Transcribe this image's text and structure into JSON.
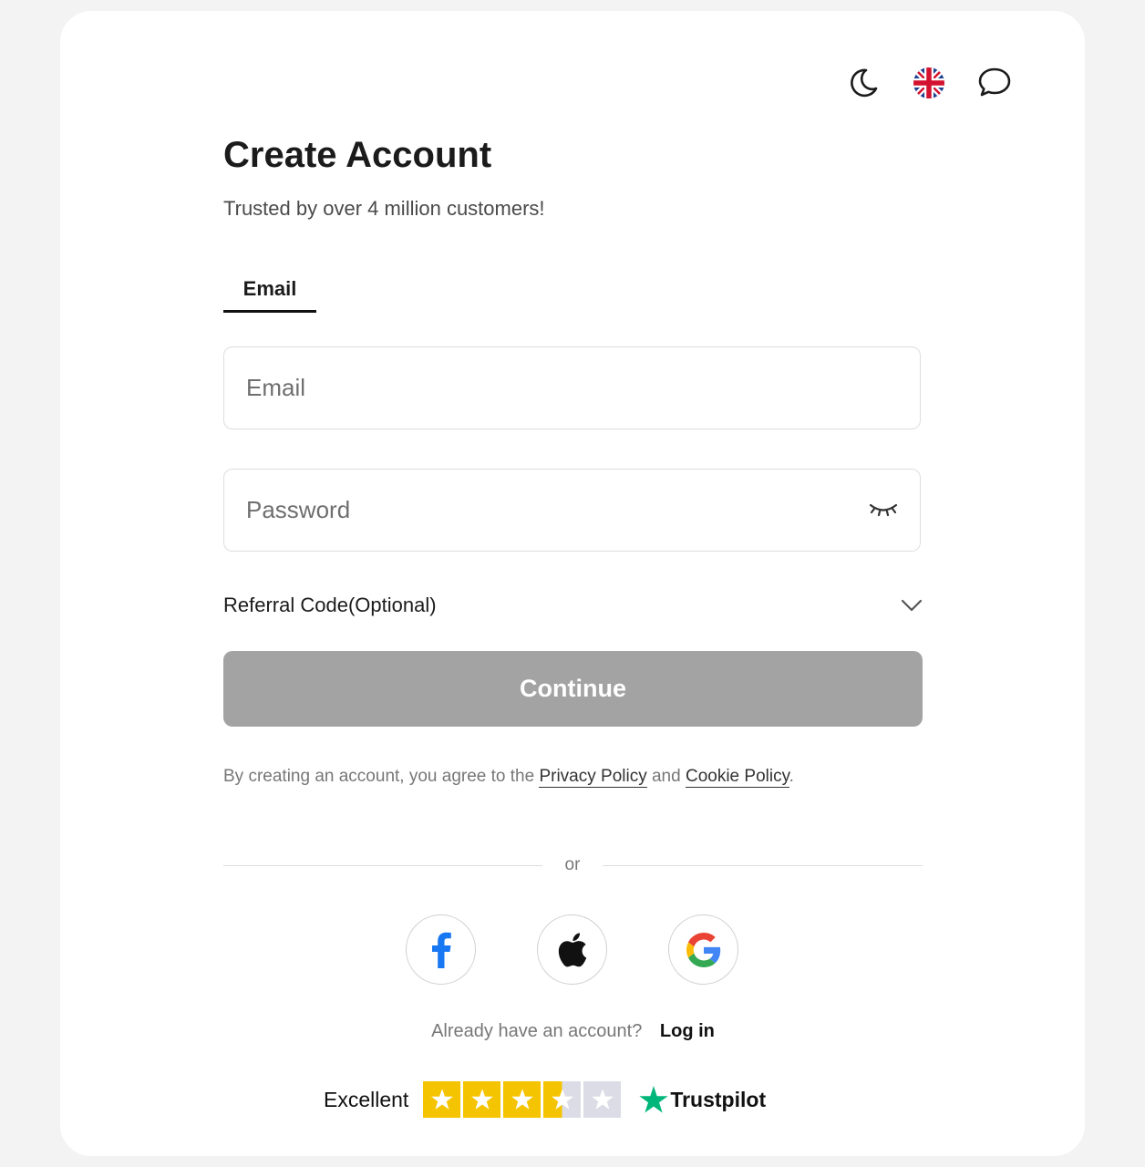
{
  "header": {
    "icons": [
      "moon-icon",
      "uk-flag-icon",
      "chat-icon"
    ]
  },
  "page": {
    "title": "Create Account",
    "subtitle": "Trusted by over 4 million customers!"
  },
  "tabs": [
    {
      "label": "Email",
      "active": true
    }
  ],
  "form": {
    "email_placeholder": "Email",
    "password_placeholder": "Password",
    "referral_label": "Referral Code(Optional)",
    "continue_label": "Continue"
  },
  "terms": {
    "prefix": "By creating an account, you agree to the",
    "privacy": "Privacy Policy",
    "and": "and",
    "cookie": "Cookie Policy",
    "suffix": "."
  },
  "divider": {
    "label": "or"
  },
  "social": [
    {
      "name": "facebook",
      "icon": "facebook-icon"
    },
    {
      "name": "apple",
      "icon": "apple-icon"
    },
    {
      "name": "google",
      "icon": "google-icon"
    }
  ],
  "login": {
    "question": "Already have an account?",
    "link": "Log in"
  },
  "trustpilot": {
    "rating_label": "Excellent",
    "stars": 3.5,
    "brand": "Trustpilot"
  },
  "colors": {
    "star_fill": "#f5c400",
    "star_empty": "#dcdce6",
    "trustpilot_green": "#00b67a",
    "facebook_blue": "#1877f2",
    "button_disabled": "#a3a3a3"
  }
}
